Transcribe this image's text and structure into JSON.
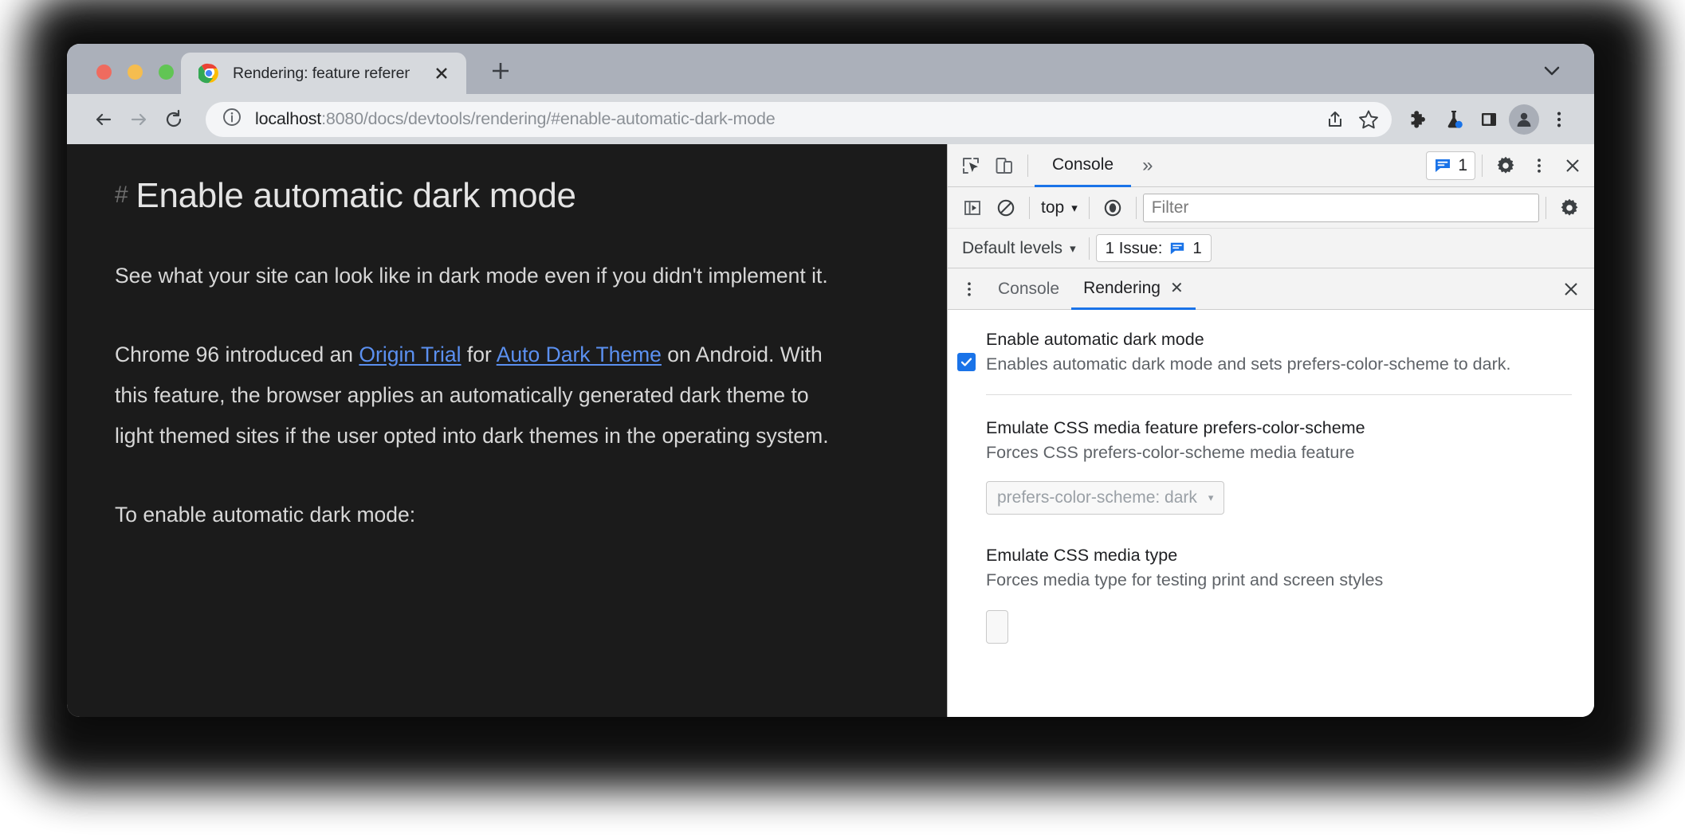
{
  "window": {
    "traffic_lights": [
      "close",
      "minimize",
      "zoom"
    ],
    "tab": {
      "title": "Rendering: feature reference -",
      "favicon": "chrome-icon",
      "close_label": "✕"
    },
    "new_tab_label": "+",
    "tabstrip_chevron": "chevron-down-icon"
  },
  "toolbar": {
    "back": "←",
    "forward": "→",
    "reload": "⟳",
    "url_secure_part": "localhost",
    "url_rest": ":8080/docs/devtools/rendering/#enable-automatic-dark-mode",
    "share_icon": "share-icon",
    "bookmark_icon": "star-icon",
    "extensions_icon": "puzzle-icon",
    "experiments_icon": "flask-icon",
    "side_panel_icon": "side-panel-icon",
    "profile_icon": "avatar-icon",
    "menu_icon": "three-dot-menu-icon"
  },
  "page": {
    "heading_anchor": "#",
    "heading": "Enable automatic dark mode",
    "paragraph_1": "See what your site can look like in dark mode even if you didn't implement it.",
    "paragraph_2_pre": "Chrome 96 introduced an ",
    "link_1": "Origin Trial",
    "paragraph_2_mid": " for ",
    "link_2": "Auto Dark Theme",
    "paragraph_2_post": " on Android. With this feature, the browser applies an automatically generated dark theme to light themed sites if the user opted into dark themes in the operating system.",
    "paragraph_3": "To enable automatic dark mode:"
  },
  "devtools": {
    "header": {
      "inspect_icon": "inspect-element-icon",
      "device_icon": "device-toolbar-icon",
      "active_tab": "Console",
      "overflow": "»",
      "issues_count": "1",
      "settings_icon": "gear-icon",
      "more_icon": "three-dot-menu-icon",
      "close_icon": "close-icon"
    },
    "console_bar": {
      "sidebar_icon": "console-sidebar-icon",
      "clear_icon": "clear-console-icon",
      "context": "top",
      "context_caret": "▾",
      "eye_icon": "live-expression-icon",
      "filter_placeholder": "Filter",
      "filter_value": "",
      "settings_icon": "gear-icon"
    },
    "levels_bar": {
      "levels_label": "Default levels",
      "levels_caret": "▾",
      "issue_label": "1 Issue:",
      "issue_count": "1"
    },
    "drawer_bar": {
      "more_icon": "three-dot-menu-icon",
      "tab_console": "Console",
      "tab_rendering": "Rendering",
      "tab_rendering_close": "✕",
      "close_icon": "close-icon"
    },
    "rendering": {
      "sections": [
        {
          "title": "Enable automatic dark mode",
          "description": "Enables automatic dark mode and sets prefers-color-scheme to dark.",
          "checked": true
        },
        {
          "title": "Emulate CSS media feature prefers-color-scheme",
          "description": "Forces CSS prefers-color-scheme media feature",
          "select_value": "prefers-color-scheme: dark",
          "select_caret": "▾"
        },
        {
          "title": "Emulate CSS media type",
          "description": "Forces media type for testing print and screen styles"
        }
      ]
    }
  },
  "colors": {
    "accent_blue": "#1a73e8",
    "link_blue": "#5b90f0",
    "page_bg": "#1b1b1b",
    "tabstrip": "#abb0ba",
    "toolbar": "#d6d9dd"
  }
}
